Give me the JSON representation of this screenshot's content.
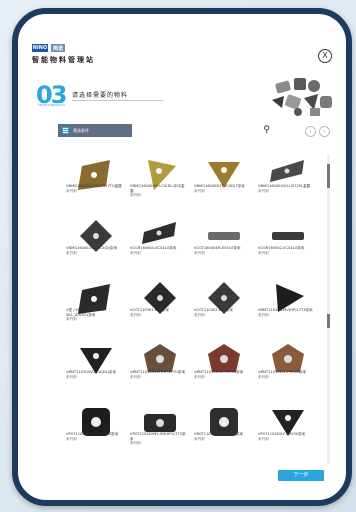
{
  "header": {
    "logo_primary": "NINO",
    "logo_secondary": "简诺",
    "app_title": "智能物料管理站",
    "close_label": "X"
  },
  "step": {
    "number": "03",
    "subtitle": "SELECT PRODUCT",
    "title": "请选择需要的物料"
  },
  "toolbar": {
    "filter_label": "筛选条件",
    "search_icon": "search-icon",
    "prev_icon": "chevron-left-icon",
    "next_icon": "chevron-right-icon"
  },
  "products": [
    {
      "name": "VNMG160404-SM(GP)17TU金属",
      "state": "未开封",
      "color": "#8a6a2e",
      "shape": "rhombus"
    },
    {
      "name": "VNMG160408VG-CA(DL)中中金属",
      "state": "未开封",
      "color": "#b29a3e",
      "shape": "triangle"
    },
    {
      "name": "VNMG160408-TF-E(SD)7奈米",
      "state": "未开封",
      "color": "#9c7a30",
      "shape": "triangle-down"
    },
    {
      "name": "VNMG160404VG-US725L金属",
      "state": "未开封",
      "color": "#4a4a4a",
      "shape": "rhombus-flat"
    },
    {
      "name": "VNMG160402VG-EC5(D)奈米",
      "state": "未开封",
      "color": "#3a3a3a",
      "shape": "diamond"
    },
    {
      "name": "VCGR160404-EC5410奈米",
      "state": "未开封",
      "color": "#2e2e2e",
      "shape": "rhombus-flat"
    },
    {
      "name": "VCGT160404M-E5510奈米",
      "state": "未开封",
      "color": "#6a6a6a",
      "shape": "flat"
    },
    {
      "name": "VCGR160402-EC5410奈米",
      "state": "未开封",
      "color": "#3a3a3a",
      "shape": "flat"
    },
    {
      "name": "V型 / VNMM160402W-SK1_AT0301奈米",
      "state": "未开封",
      "color": "#2a2a2a",
      "shape": "rhombus"
    },
    {
      "name": "VCGT110301-K10奈米",
      "state": "未开封",
      "color": "#2a2a2a",
      "shape": "diamond"
    },
    {
      "name": "VCGT110302-K10奈米",
      "state": "未开封",
      "color": "#3a3a3a",
      "shape": "diamond"
    },
    {
      "name": "VBMT110308-MV(HP)17T3奈米",
      "state": "未开封",
      "color": "#1e1e1e",
      "shape": "triangle-right"
    },
    {
      "name": "VBMT110304VG-CA(DL)奈米",
      "state": "未开封",
      "color": "#222222",
      "shape": "triangle-down"
    },
    {
      "name": "VBMT110304-MV(HP)17TU奈米",
      "state": "未开封",
      "color": "#6b4e3a",
      "shape": "round"
    },
    {
      "name": "VBMT110302MV-PR930奈米",
      "state": "未开封",
      "color": "#7a3a2e",
      "shape": "round"
    },
    {
      "name": "VBMT110302LF-PR930奈米",
      "state": "未开封",
      "color": "#8a5a3a",
      "shape": "round"
    },
    {
      "name": "VPGT110302CR/U-PR930奈米",
      "state": "未开封",
      "color": "#1e1e1e",
      "shape": "square"
    },
    {
      "name": "VPGT110302MV-SM(HP)17T3奈米",
      "state": "未开封",
      "color": "#2a2a2a",
      "shape": "rect"
    },
    {
      "name": "VBGT110302LF-MS7TM奈米",
      "state": "未开封",
      "color": "#2e2e2e",
      "shape": "square"
    },
    {
      "name": "VPGT110302LF-PR930奈米",
      "state": "未开封",
      "color": "#222222",
      "shape": "triangle-down"
    },
    {
      "name": "",
      "state": "",
      "color": "#555555",
      "shape": "small"
    },
    {
      "name": "",
      "state": "",
      "color": "#6a4a2a",
      "shape": "small"
    },
    {
      "name": "",
      "state": "",
      "color": "#555555",
      "shape": "small"
    },
    {
      "name": "",
      "state": "",
      "color": "#555555",
      "shape": "small"
    }
  ],
  "footer": {
    "next_label": "下一步"
  },
  "colors": {
    "accent": "#29a6e0",
    "frame": "#1e3a5f",
    "filter_bg": "#5f6e82"
  }
}
